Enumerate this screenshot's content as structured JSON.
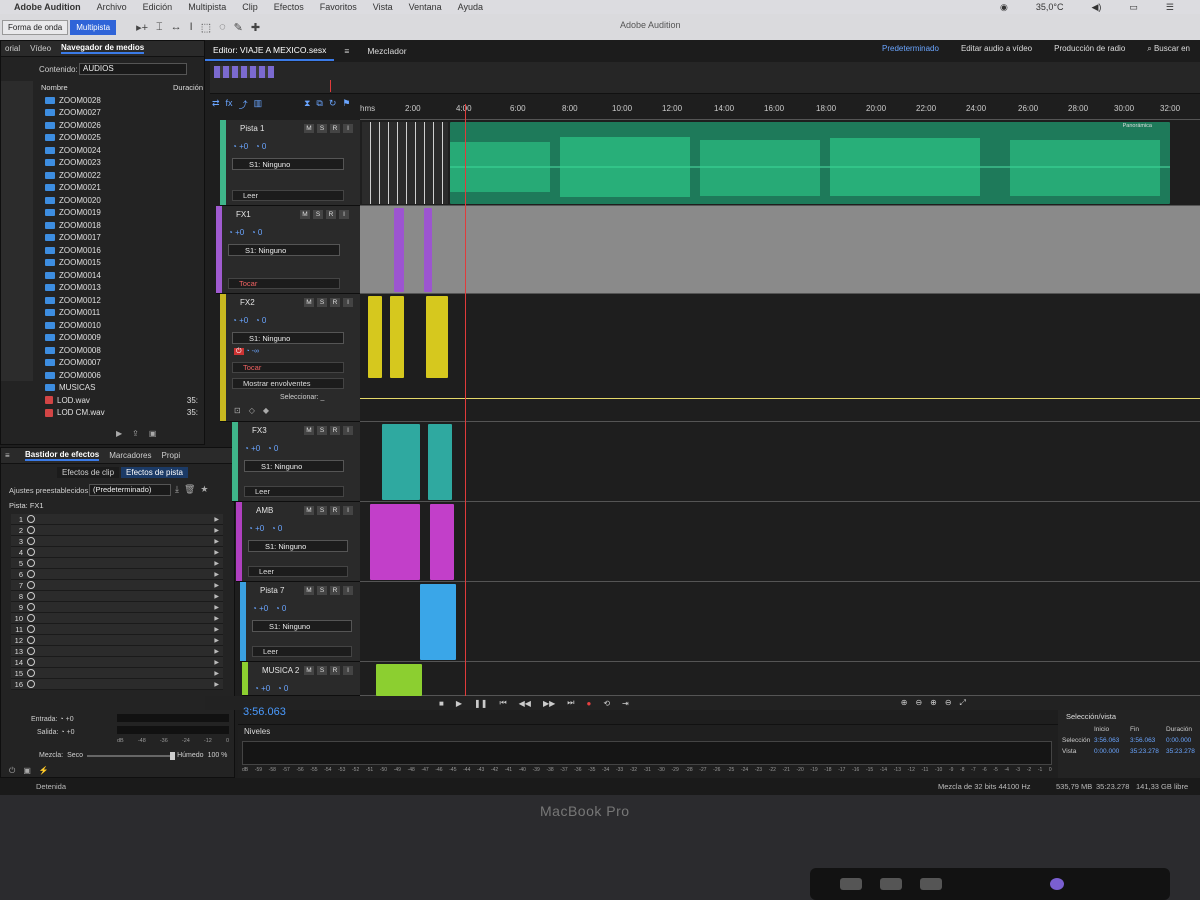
{
  "menubar": {
    "app": "Adobe Audition",
    "items": [
      "Archivo",
      "Edición",
      "Multipista",
      "Clip",
      "Efectos",
      "Favoritos",
      "Vista",
      "Ventana",
      "Ayuda"
    ],
    "temperature": "35,0°C"
  },
  "toolbar": {
    "waveform_label": "Forma de onda",
    "multitrack_label": "Multipista",
    "window_title": "Adobe Audition"
  },
  "workspaces": {
    "items": [
      "Predeterminado",
      "Editar audio a vídeo",
      "Producción de radio"
    ],
    "active": "Predeterminado",
    "search": "Buscar en"
  },
  "media_browser": {
    "tabs": [
      "orial",
      "Vídeo",
      "Navegador de medios"
    ],
    "contents_label": "Contenido:",
    "contents_value": "AUDIOS",
    "col_name": "Nombre",
    "col_duration": "Duración",
    "items": [
      "ZOOM0028",
      "ZOOM0027",
      "ZOOM0026",
      "ZOOM0025",
      "ZOOM0024",
      "ZOOM0023",
      "ZOOM0022",
      "ZOOM0021",
      "ZOOM0020",
      "ZOOM0019",
      "ZOOM0018",
      "ZOOM0017",
      "ZOOM0016",
      "ZOOM0015",
      "ZOOM0014",
      "ZOOM0013",
      "ZOOM0012",
      "ZOOM0011",
      "ZOOM0010",
      "ZOOM0009",
      "ZOOM0008",
      "ZOOM0007",
      "ZOOM0006",
      "MUSICAS"
    ],
    "files": [
      {
        "name": "LOD.wav",
        "dur": "35:"
      },
      {
        "name": "LOD CM.wav",
        "dur": "35:"
      }
    ]
  },
  "effects_rack": {
    "tabs": [
      "Bastidor de efectos",
      "Marcadores",
      "Propi"
    ],
    "subtabs": [
      "Efectos de clip",
      "Efectos de pista"
    ],
    "presets_label": "Ajustes preestablecidos:",
    "presets_value": "(Predeterminado)",
    "track_label": "Pista: FX1",
    "slots": [
      "1",
      "2",
      "3",
      "4",
      "5",
      "6",
      "7",
      "8",
      "9",
      "10",
      "11",
      "12",
      "13",
      "14",
      "15",
      "16"
    ],
    "input_label": "Entrada:",
    "input_value": "+0",
    "output_label": "Salida:",
    "output_value": "+0",
    "mix_label": "Mezcla:",
    "dry": "Seco",
    "wet": "Húmedo",
    "mix_value": "100 %",
    "db_scale": [
      "dB",
      "-48",
      "-36",
      "-24",
      "-12",
      "0"
    ]
  },
  "editor": {
    "tab_editor": "Editor: VIAJE A MEXICO.sesx",
    "tab_mixer": "Mezclador",
    "ruler_unit": "hms",
    "ruler": [
      "2:00",
      "4:00",
      "6:00",
      "8:00",
      "10:00",
      "12:00",
      "14:00",
      "16:00",
      "18:00",
      "20:00",
      "22:00",
      "24:00",
      "26:00",
      "28:00",
      "30:00",
      "32:00"
    ],
    "panoramica": "Panorámica"
  },
  "tracks": [
    {
      "name": "Pista 1",
      "vol": "+0",
      "pan": "0",
      "bus": "S1: Ninguno",
      "mode": "Leer",
      "color": "#3fb58a"
    },
    {
      "name": "FX1",
      "vol": "+0",
      "pan": "0",
      "bus": "S1: Ninguno",
      "mode": "Tocar",
      "color": "#a05bd0"
    },
    {
      "name": "FX2",
      "vol": "+0",
      "pan": "0",
      "bus": "S1: Ninguno",
      "mode": "Tocar",
      "color": "#c8b820",
      "env": "Mostrar envolventes",
      "select": "Seleccionar:",
      "extra_vol": "-∞"
    },
    {
      "name": "FX3",
      "vol": "+0",
      "pan": "0",
      "bus": "S1: Ninguno",
      "mode": "Leer",
      "color": "#3fb58a"
    },
    {
      "name": "AMB",
      "vol": "+0",
      "pan": "0",
      "bus": "S1: Ninguno",
      "mode": "Leer",
      "color": "#b040c0"
    },
    {
      "name": "Pista 7",
      "vol": "+0",
      "pan": "0",
      "bus": "S1: Ninguno",
      "mode": "Leer",
      "color": "#3aa0e0"
    },
    {
      "name": "MUSICA 2",
      "vol": "+0",
      "pan": "0",
      "bus": "",
      "mode": "",
      "color": "#8ccf30"
    }
  ],
  "transport": {
    "timecode": "3:56.063"
  },
  "levels": {
    "title": "Niveles",
    "scale": [
      "dB",
      "-59",
      "-58",
      "-57",
      "-56",
      "-55",
      "-54",
      "-53",
      "-52",
      "-51",
      "-50",
      "-49",
      "-48",
      "-47",
      "-46",
      "-45",
      "-44",
      "-43",
      "-42",
      "-41",
      "-40",
      "-39",
      "-38",
      "-37",
      "-36",
      "-35",
      "-34",
      "-33",
      "-32",
      "-31",
      "-30",
      "-29",
      "-28",
      "-27",
      "-26",
      "-25",
      "-24",
      "-23",
      "-22",
      "-21",
      "-20",
      "-19",
      "-18",
      "-17",
      "-16",
      "-15",
      "-14",
      "-13",
      "-12",
      "-11",
      "-10",
      "-9",
      "-8",
      "-7",
      "-6",
      "-5",
      "-4",
      "-3",
      "-2",
      "-1",
      "0"
    ]
  },
  "selection_view": {
    "title": "Selección/vista",
    "col_start": "Inicio",
    "col_end": "Fin",
    "col_duration": "Duración",
    "sel_label": "Selección",
    "sel": [
      "3:56.063",
      "3:56.063",
      "0:00.000"
    ],
    "view_label": "Vista",
    "view": [
      "0:00.000",
      "35:23.278",
      "35:23.278"
    ]
  },
  "status": {
    "left": "Detenida",
    "mix": "Mezcla de 32 bits 44100 Hz",
    "mem": "535,79 MB",
    "dur": "35:23.278",
    "free": "141,33 GB libre"
  },
  "laptop": {
    "label": "MacBook Pro"
  }
}
